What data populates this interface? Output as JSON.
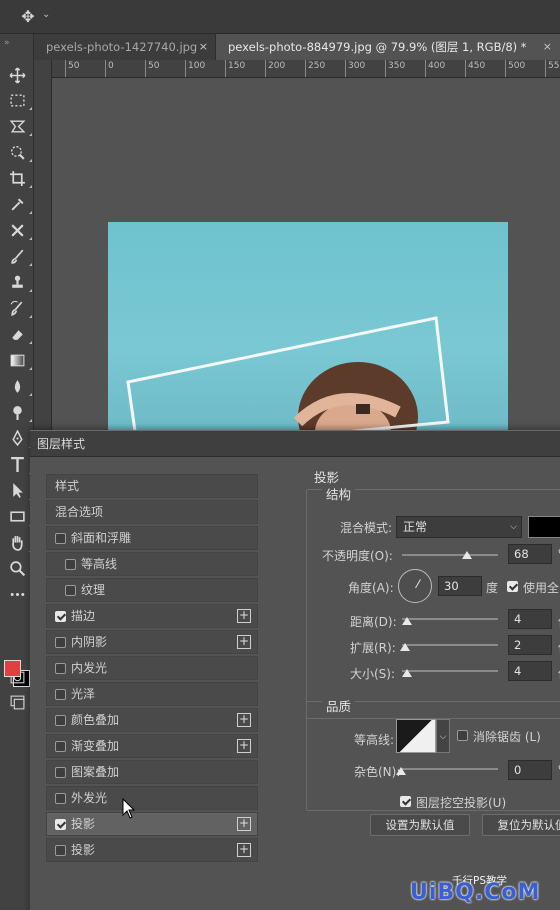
{
  "tabs": [
    {
      "label": "pexels-photo-1427740.jpg",
      "close": "×"
    },
    {
      "label": "pexels-photo-884979.jpg @ 79.9% (图层 1, RGB/8) *",
      "close": "×"
    }
  ],
  "ruler": {
    "ticks": [
      "50",
      "0",
      "50",
      "100",
      "150",
      "200",
      "250",
      "300",
      "350",
      "400",
      "450",
      "500",
      "55"
    ]
  },
  "dialog": {
    "title": "图层样式",
    "left_items": [
      {
        "label": "样式",
        "checkbox": false,
        "checked": false,
        "plus": false,
        "indent": 0
      },
      {
        "label": "混合选项",
        "checkbox": false,
        "checked": false,
        "plus": false,
        "indent": 0
      },
      {
        "label": "斜面和浮雕",
        "checkbox": true,
        "checked": false,
        "plus": false,
        "indent": 0
      },
      {
        "label": "等高线",
        "checkbox": true,
        "checked": false,
        "plus": false,
        "indent": 1
      },
      {
        "label": "纹理",
        "checkbox": true,
        "checked": false,
        "plus": false,
        "indent": 1
      },
      {
        "label": "描边",
        "checkbox": true,
        "checked": true,
        "plus": true,
        "indent": 0
      },
      {
        "label": "内阴影",
        "checkbox": true,
        "checked": false,
        "plus": true,
        "indent": 0
      },
      {
        "label": "内发光",
        "checkbox": true,
        "checked": false,
        "plus": false,
        "indent": 0
      },
      {
        "label": "光泽",
        "checkbox": true,
        "checked": false,
        "plus": false,
        "indent": 0
      },
      {
        "label": "颜色叠加",
        "checkbox": true,
        "checked": false,
        "plus": true,
        "indent": 0
      },
      {
        "label": "渐变叠加",
        "checkbox": true,
        "checked": false,
        "plus": true,
        "indent": 0
      },
      {
        "label": "图案叠加",
        "checkbox": true,
        "checked": false,
        "plus": false,
        "indent": 0
      },
      {
        "label": "外发光",
        "checkbox": true,
        "checked": false,
        "plus": false,
        "indent": 0
      },
      {
        "label": "投影",
        "checkbox": true,
        "checked": true,
        "plus": true,
        "indent": 0,
        "selected": true
      },
      {
        "label": "投影",
        "checkbox": true,
        "checked": false,
        "plus": true,
        "indent": 0
      }
    ],
    "section_title": "投影",
    "structure": {
      "title": "结构",
      "blend_mode_label": "混合模式:",
      "blend_mode_value": "正常",
      "blend_color": "#000000",
      "opacity_label": "不透明度(O):",
      "opacity_value": "68",
      "opacity_unit": "%",
      "opacity_level": 0.68,
      "angle_label": "角度(A):",
      "angle_value": "30",
      "angle_unit": "度",
      "global_light_label": "使用全",
      "distance_label": "距离(D):",
      "distance_value": "4",
      "spread_label": "扩展(R):",
      "spread_value": "2",
      "size_label": "大小(S):",
      "size_value": "4",
      "px_unit": "像"
    },
    "quality": {
      "title": "品质",
      "contour_label": "等高线:",
      "antialias_label": "消除锯齿 (L)",
      "noise_label": "杂色(N):",
      "noise_value": "0",
      "noise_unit": "%"
    },
    "knockout_label": "图层挖空投影(U)",
    "make_default": "设置为默认值",
    "reset_default": "复位为默认值"
  },
  "watermark": {
    "brand": "UiBQ.CoM",
    "sub": "千行PS教学"
  }
}
